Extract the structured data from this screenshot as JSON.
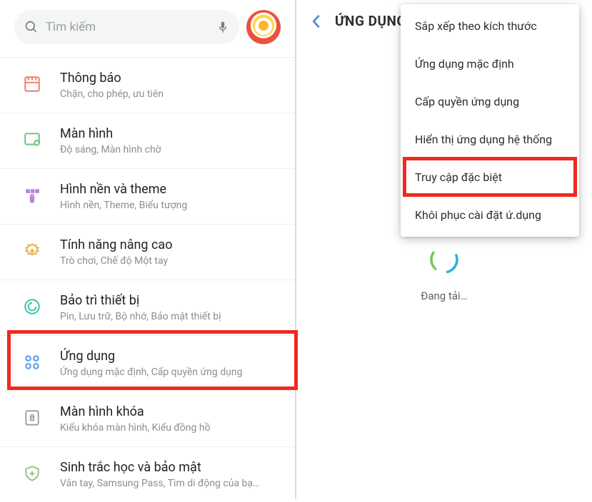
{
  "search": {
    "placeholder": "Tìm kiếm"
  },
  "settings": [
    {
      "icon": "notifications-icon",
      "color": "#ef7d6a",
      "title": "Thông báo",
      "sub": "Chặn, cho phép, ưu tiên"
    },
    {
      "icon": "display-icon",
      "color": "#67c57e",
      "title": "Màn hình",
      "sub": "Độ sáng, Màn hình chờ"
    },
    {
      "icon": "wallpaper-icon",
      "color": "#b57fdb",
      "title": "Hình nền và theme",
      "sub": "Hình nền, Theme, Biểu tượng"
    },
    {
      "icon": "advanced-icon",
      "color": "#f2b04c",
      "title": "Tính năng nâng cao",
      "sub": "Trò chơi, Chế độ Một tay"
    },
    {
      "icon": "device-care-icon",
      "color": "#3fc0a8",
      "title": "Bảo trì thiết bị",
      "sub": "Pin, Lưu trữ, Bộ nhớ, Bảo mật thiết bị"
    },
    {
      "icon": "apps-icon",
      "color": "#5aa0e8",
      "title": "Ứng dụng",
      "sub": "Ứng dụng mặc định, Cấp quyền ứng dụng"
    },
    {
      "icon": "lockscreen-icon",
      "color": "#9fa3a7",
      "title": "Màn hình khóa",
      "sub": "Kiểu khóa màn hình, Kiểu đồng hồ"
    },
    {
      "icon": "biometrics-icon",
      "color": "#8fc679",
      "title": "Sinh trắc học và bảo mật",
      "sub": "Vân tay, Samsung Pass, Tìm di động của bạ…"
    }
  ],
  "right": {
    "title": "ỨNG DỤNG",
    "menu": [
      "Sắp xếp theo kích thước",
      "Ứng dụng mặc định",
      "Cấp quyền ứng dụng",
      "Hiển thị ứng dụng hệ thống",
      "Truy cập đặc biệt",
      "Khôi phục cài đặt ứ.dụng"
    ],
    "loading": "Đang tải…"
  }
}
